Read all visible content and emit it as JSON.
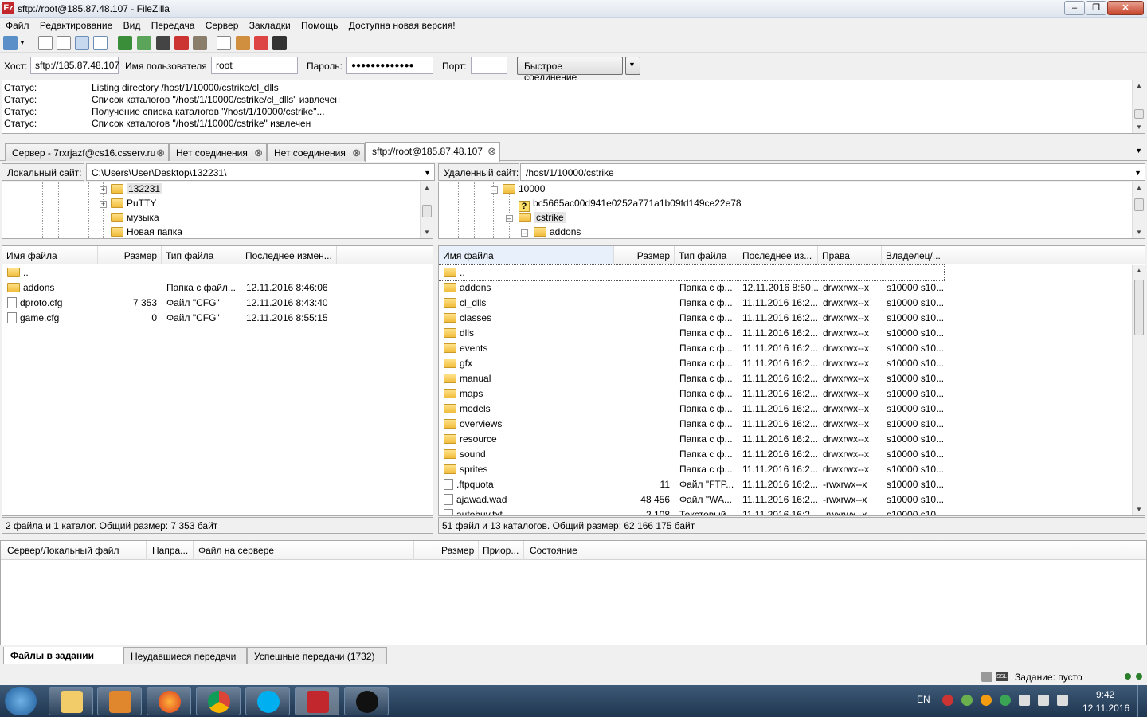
{
  "window": {
    "title": "sftp://root@185.87.48.107 - FileZilla",
    "app_icon": "Fz"
  },
  "menu": [
    "Файл",
    "Редактирование",
    "Вид",
    "Передача",
    "Сервер",
    "Закладки",
    "Помощь",
    "Доступна новая версия!"
  ],
  "quickconnect": {
    "host_label": "Хост:",
    "host_value": "sftp://185.87.48.107",
    "user_label": "Имя пользователя",
    "user_value": "root",
    "pass_label": "Пароль:",
    "pass_value": "●●●●●●●●●●●●●",
    "port_label": "Порт:",
    "port_value": "",
    "connect_label": "Быстрое соединение",
    "dropdown": "▼"
  },
  "log": [
    {
      "k": "Статус:",
      "v": "Listing directory /host/1/10000/cstrike/cl_dlls"
    },
    {
      "k": "Статус:",
      "v": "Список каталогов \"/host/1/10000/cstrike/cl_dlls\" извлечен"
    },
    {
      "k": "Статус:",
      "v": "Получение списка каталогов \"/host/1/10000/cstrike\"..."
    },
    {
      "k": "Статус:",
      "v": "Список каталогов \"/host/1/10000/cstrike\" извлечен"
    }
  ],
  "tabs": [
    {
      "label": "Сервер - 7rxrjazf@cs16.csserv.ru"
    },
    {
      "label": "Нет соединения"
    },
    {
      "label": "Нет соединения"
    },
    {
      "label": "sftp://root@185.87.48.107"
    }
  ],
  "tab_close": "⊗",
  "local": {
    "site_label": "Локальный сайт:",
    "path": "C:\\Users\\User\\Desktop\\132231\\",
    "tree": [
      "132231",
      "PuTTY",
      "музыка",
      "Новая папка"
    ],
    "columns": [
      "Имя файла",
      "Размер",
      "Тип файла",
      "Последнее измен..."
    ],
    "files": [
      {
        "name": "..",
        "size": "",
        "type": "",
        "date": "",
        "kind": "folder"
      },
      {
        "name": "addons",
        "size": "",
        "type": "Папка с файл...",
        "date": "12.11.2016 8:46:06",
        "kind": "folder"
      },
      {
        "name": "dproto.cfg",
        "size": "7 353",
        "type": "Файл \"CFG\"",
        "date": "12.11.2016 8:43:40",
        "kind": "file"
      },
      {
        "name": "game.cfg",
        "size": "0",
        "type": "Файл \"CFG\"",
        "date": "12.11.2016 8:55:15",
        "kind": "file"
      }
    ],
    "status": "2 файла и 1 каталог. Общий размер: 7 353 байт"
  },
  "remote": {
    "site_label": "Удаленный сайт:",
    "path": "/host/1/10000/cstrike",
    "tree": [
      {
        "label": "10000",
        "kind": "folder"
      },
      {
        "label": "bc5665ac00d941e0252a771a1b09fd149ce22e78",
        "kind": "question"
      },
      {
        "label": "cstrike",
        "kind": "folder"
      },
      {
        "label": "addons",
        "kind": "folder"
      }
    ],
    "columns": [
      "Имя файла",
      "Размер",
      "Тип файла",
      "Последнее из...",
      "Права",
      "Владелец/..."
    ],
    "files": [
      {
        "name": "..",
        "size": "",
        "type": "",
        "date": "",
        "perm": "",
        "owner": "",
        "kind": "folder"
      },
      {
        "name": "addons",
        "size": "",
        "type": "Папка с ф...",
        "date": "12.11.2016 8:50...",
        "perm": "drwxrwx--x",
        "owner": "s10000 s10...",
        "kind": "folder"
      },
      {
        "name": "cl_dlls",
        "size": "",
        "type": "Папка с ф...",
        "date": "11.11.2016 16:2...",
        "perm": "drwxrwx--x",
        "owner": "s10000 s10...",
        "kind": "folder"
      },
      {
        "name": "classes",
        "size": "",
        "type": "Папка с ф...",
        "date": "11.11.2016 16:2...",
        "perm": "drwxrwx--x",
        "owner": "s10000 s10...",
        "kind": "folder"
      },
      {
        "name": "dlls",
        "size": "",
        "type": "Папка с ф...",
        "date": "11.11.2016 16:2...",
        "perm": "drwxrwx--x",
        "owner": "s10000 s10...",
        "kind": "folder"
      },
      {
        "name": "events",
        "size": "",
        "type": "Папка с ф...",
        "date": "11.11.2016 16:2...",
        "perm": "drwxrwx--x",
        "owner": "s10000 s10...",
        "kind": "folder"
      },
      {
        "name": "gfx",
        "size": "",
        "type": "Папка с ф...",
        "date": "11.11.2016 16:2...",
        "perm": "drwxrwx--x",
        "owner": "s10000 s10...",
        "kind": "folder"
      },
      {
        "name": "manual",
        "size": "",
        "type": "Папка с ф...",
        "date": "11.11.2016 16:2...",
        "perm": "drwxrwx--x",
        "owner": "s10000 s10...",
        "kind": "folder"
      },
      {
        "name": "maps",
        "size": "",
        "type": "Папка с ф...",
        "date": "11.11.2016 16:2...",
        "perm": "drwxrwx--x",
        "owner": "s10000 s10...",
        "kind": "folder"
      },
      {
        "name": "models",
        "size": "",
        "type": "Папка с ф...",
        "date": "11.11.2016 16:2...",
        "perm": "drwxrwx--x",
        "owner": "s10000 s10...",
        "kind": "folder"
      },
      {
        "name": "overviews",
        "size": "",
        "type": "Папка с ф...",
        "date": "11.11.2016 16:2...",
        "perm": "drwxrwx--x",
        "owner": "s10000 s10...",
        "kind": "folder"
      },
      {
        "name": "resource",
        "size": "",
        "type": "Папка с ф...",
        "date": "11.11.2016 16:2...",
        "perm": "drwxrwx--x",
        "owner": "s10000 s10...",
        "kind": "folder"
      },
      {
        "name": "sound",
        "size": "",
        "type": "Папка с ф...",
        "date": "11.11.2016 16:2...",
        "perm": "drwxrwx--x",
        "owner": "s10000 s10...",
        "kind": "folder"
      },
      {
        "name": "sprites",
        "size": "",
        "type": "Папка с ф...",
        "date": "11.11.2016 16:2...",
        "perm": "drwxrwx--x",
        "owner": "s10000 s10...",
        "kind": "folder"
      },
      {
        "name": ".ftpquota",
        "size": "11",
        "type": "Файл \"FTP...",
        "date": "11.11.2016 16:2...",
        "perm": "-rwxrwx--x",
        "owner": "s10000 s10...",
        "kind": "file"
      },
      {
        "name": "ajawad.wad",
        "size": "48 456",
        "type": "Файл \"WA...",
        "date": "11.11.2016 16:2...",
        "perm": "-rwxrwx--x",
        "owner": "s10000 s10...",
        "kind": "file"
      },
      {
        "name": "autobuy.txt",
        "size": "2 108",
        "type": "Текстовый...",
        "date": "11.11.2016 16:2...",
        "perm": "-rwxrwx--x",
        "owner": "s10000 s10...",
        "kind": "file"
      }
    ],
    "status": "51 файл и 13 каталогов. Общий размер: 62 166 175 байт"
  },
  "queue": {
    "columns": [
      "Сервер/Локальный файл",
      "Напра...",
      "Файл на сервере",
      "Размер",
      "Приор...",
      "Состояние"
    ],
    "tabs": [
      "Файлы в задании",
      "Неудавшиеся передачи",
      "Успешные передачи (1732)"
    ]
  },
  "statusbar": {
    "queue": "Задание: пусто",
    "encryption_icon": "SSL"
  },
  "taskbar": {
    "lang": "EN",
    "time": "9:42",
    "date": "12.11.2016"
  }
}
